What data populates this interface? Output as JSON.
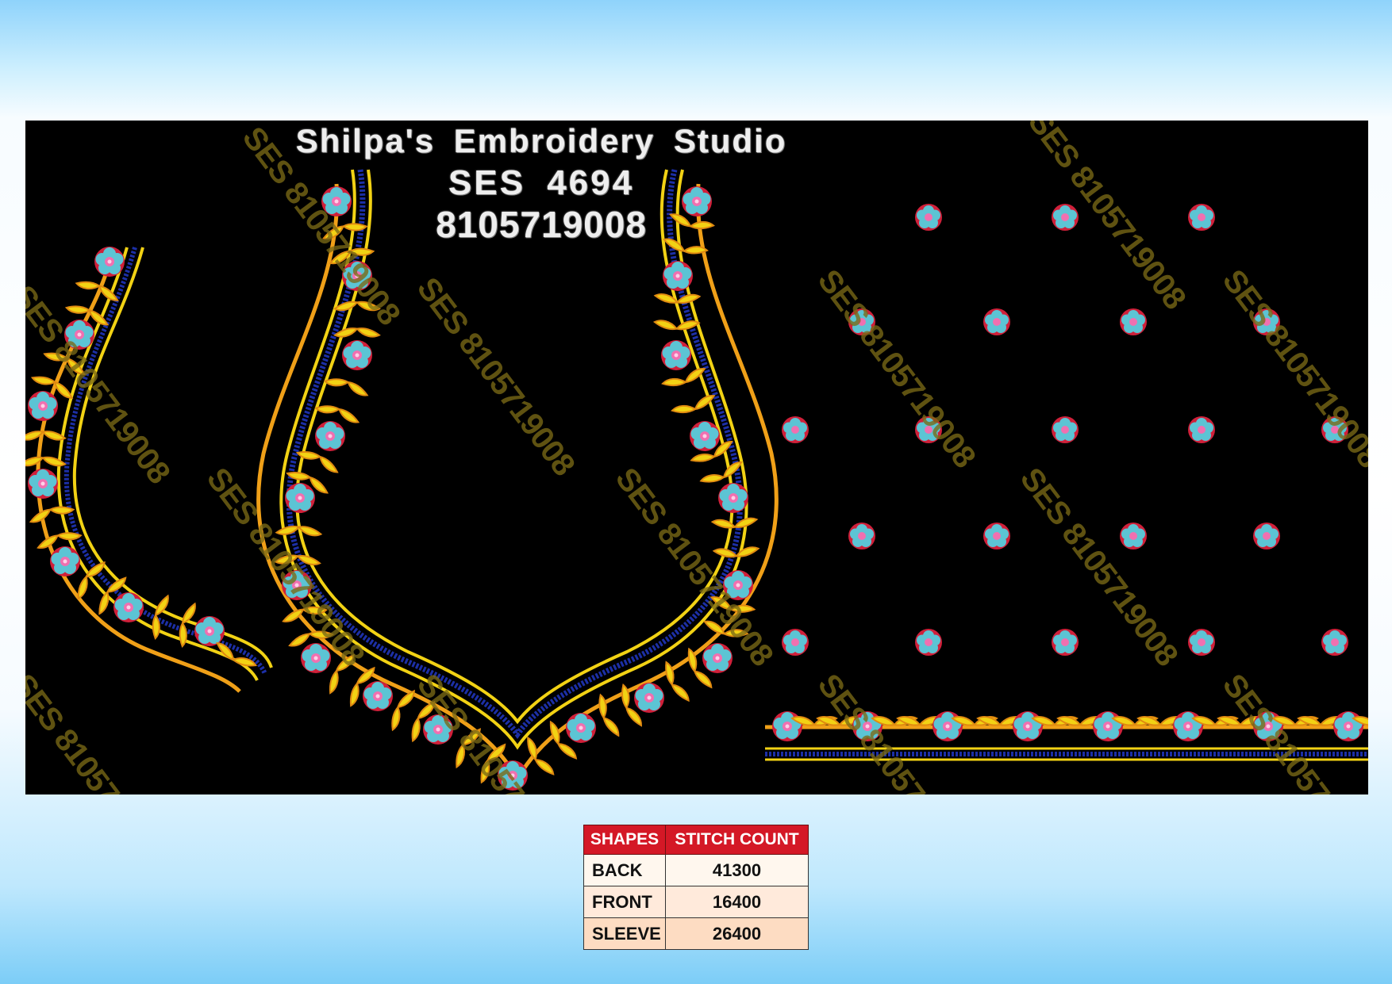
{
  "header": {
    "studio_name": "Shilpa's Embroidery Studio",
    "design_code": "SES 4694",
    "phone": "8105719008"
  },
  "watermark_text": "SES 8105719008",
  "stitch_table": {
    "headers": [
      "SHAPES",
      "STITCH COUNT"
    ],
    "rows": [
      {
        "shape": "BACK",
        "count": "41300"
      },
      {
        "shape": "FRONT",
        "count": "16400"
      },
      {
        "shape": "SLEEVE",
        "count": "26400"
      }
    ]
  },
  "colors": {
    "panel_background": "#000000",
    "gold_thread": "#f2d214",
    "orange_thread": "#f0a018",
    "blue_thread": "#1c2fa6",
    "flower_petal": "#5cc4d4",
    "flower_edge": "#d0203a",
    "flower_center": "#f070b0",
    "table_header": "#d41826"
  }
}
